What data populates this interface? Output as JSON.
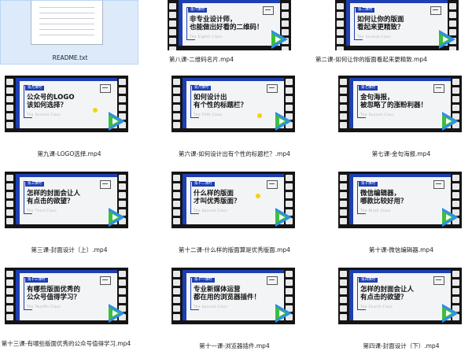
{
  "readme": {
    "label": "README.txt",
    "icon": "text-file-icon"
  },
  "videos": [
    {
      "caption": "第八课-二维码名片.mp4",
      "tag": "第八课时",
      "title": "非专业设计师，\n也能做出好看的二维码！",
      "subtitle": "The Eighth Class"
    },
    {
      "caption": "第二课-如何让你的版面看起来更精致.mp4",
      "tag": "第二课时",
      "title": "如何让你的版面\n看起来更精致？",
      "subtitle": "The Second Class"
    },
    {
      "caption": "第九课-LOGO选择.mp4",
      "tag": "第九课时",
      "title": "公众号的LOGO\n该如何选择？",
      "subtitle": "The Second Class"
    },
    {
      "caption": "第六课-如何设计出有个性的标题栏？.mp4",
      "tag": "第六课时",
      "title": "如何设计出\n有个性的标题栏？",
      "subtitle": "The Fifth Class"
    },
    {
      "caption": "第七课-金句海报.mp4",
      "tag": "第七课时",
      "title": "金句海报，\n被忽略了的涨粉利器！",
      "subtitle": "The Second Class"
    },
    {
      "caption": "第三课-封面设计（上）.mp4",
      "tag": "第三课时",
      "title": "怎样的封面会让人\n有点击的欲望？",
      "subtitle": "The Third Class"
    },
    {
      "caption": "第十二课-什么样的版面算是优秀版面.mp4",
      "tag": "第十二课时",
      "title": "什么样的版面\n才叫优秀版面？",
      "subtitle": "The Second Class"
    },
    {
      "caption": "第十课-微信编辑器.mp4",
      "tag": "第十课时",
      "title": "微信编辑器，\n哪款比较好用？",
      "subtitle": "The Ninth Class"
    },
    {
      "caption": "第十三课-有哪些版面优秀的公众号值得学习.mp4",
      "tag": "第十三课时",
      "title": "有哪些版面优秀的\n公众号值得学习？",
      "subtitle": "The Twelfth Class"
    },
    {
      "caption": "第十一课-浏览器插件.mp4",
      "tag": "第十一课时",
      "title": "专业新媒体运营\n都在用的浏览器插件！",
      "subtitle": "The Second Class"
    },
    {
      "caption": "第四课-封面设计（下）.mp4",
      "tag": "第四课时",
      "title": "怎样的封面会让人\n有点击的欲望？",
      "subtitle": "The Fourth Class"
    }
  ],
  "colors": {
    "accent": "#1d3fb3",
    "selection": "#dceafa",
    "play_green": "#3dbf39",
    "play_blue": "#2e8fe6",
    "highlight_dot": "#f5d300"
  }
}
